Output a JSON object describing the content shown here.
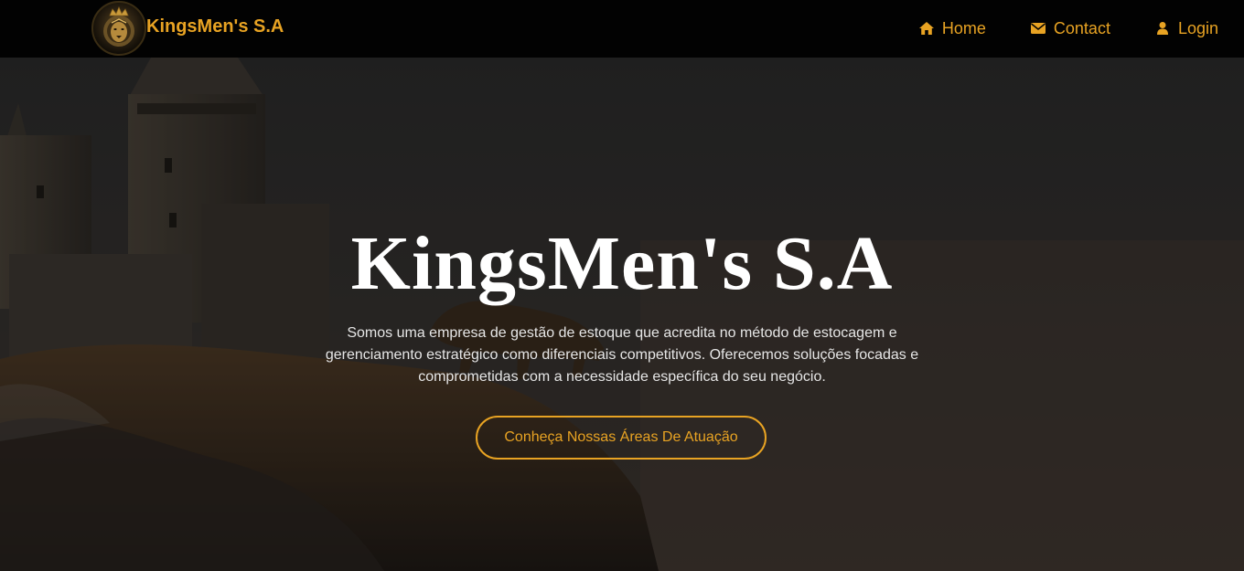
{
  "navbar": {
    "brand_name": "KingsMen's S.A",
    "logo_icon": "lion-crown-logo",
    "links": [
      {
        "label": "Home",
        "icon": "home-icon"
      },
      {
        "label": "Contact",
        "icon": "envelope-icon"
      },
      {
        "label": "Login",
        "icon": "user-icon"
      }
    ]
  },
  "hero": {
    "title": "KingsMen's S.A",
    "description": "Somos uma empresa de gestão de estoque que acredita no método de estocagem e gerenciamento estratégico como diferenciais competitivos. Oferecemos soluções focadas e comprometidas com a necessidade específica do seu negócio.",
    "cta_label": "Conheça Nossas Áreas De Atuação",
    "background": "castle-and-lion-on-cliff"
  },
  "colors": {
    "accent": "#e8a323",
    "navbar_bg": "#020202",
    "title": "#ffffff"
  }
}
